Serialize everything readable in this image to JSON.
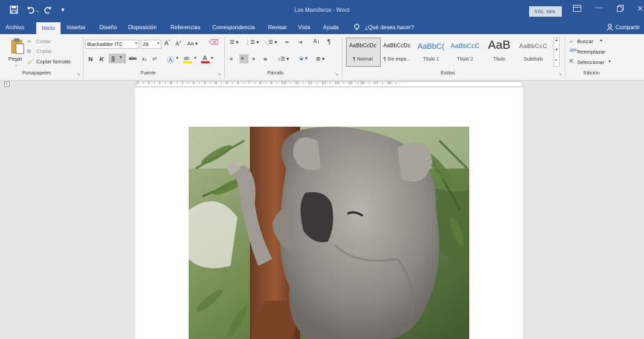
{
  "window": {
    "title": "Los Mamíferos  -  Word",
    "signin_label": "Inic. ses.",
    "share_label": "Compartir"
  },
  "tabs": [
    "Archivo",
    "Inicio",
    "Insertar",
    "Diseño",
    "Disposición",
    "Referencias",
    "Correspondencia",
    "Revisar",
    "Vista",
    "Ayuda"
  ],
  "tell_me": "¿Qué desea hacer?",
  "clipboard": {
    "paste": "Pegar",
    "cut": "Cortar",
    "copy": "Copiar",
    "format_painter": "Copiar formato",
    "group": "Portapapeles"
  },
  "font": {
    "name": "Blackadder ITC",
    "size": "28",
    "group": "Fuente"
  },
  "paragraph": {
    "group": "Párrafo"
  },
  "styles": {
    "group": "Estilos",
    "items": [
      {
        "preview": "AaBbCcDc",
        "name": "¶ Normal"
      },
      {
        "preview": "AaBbCcDc",
        "name": "¶ Sin espa..."
      },
      {
        "preview": "AaBbC(",
        "name": "Título 1"
      },
      {
        "preview": "AaBbCcC",
        "name": "Título 2"
      },
      {
        "preview": "AaB",
        "name": "Título"
      },
      {
        "preview": "AaBbCcC",
        "name": "Subtítulo"
      }
    ]
  },
  "editing": {
    "group": "Edición",
    "find": "Buscar",
    "replace": "Reemplazar",
    "select": "Seleccionar"
  },
  "ruler_text": "3 · ı · 2 · ı · 1 · ı · ⧖ · ı · 1 · ı · 2 · ı · 3 · ı · 4 · ı · 5 · ı · 6 · ı · 7 · ı · 8 · ı · 9 · ı · 10 · ı · 11 · ı · 12 · ı · 13 · ı · 14 · ı · 15 · ⌂ 16 · ı · 17 · ı · 18 · ı",
  "colors": {
    "accent": "#2b579a",
    "ribbon": "#f3f3f3"
  }
}
